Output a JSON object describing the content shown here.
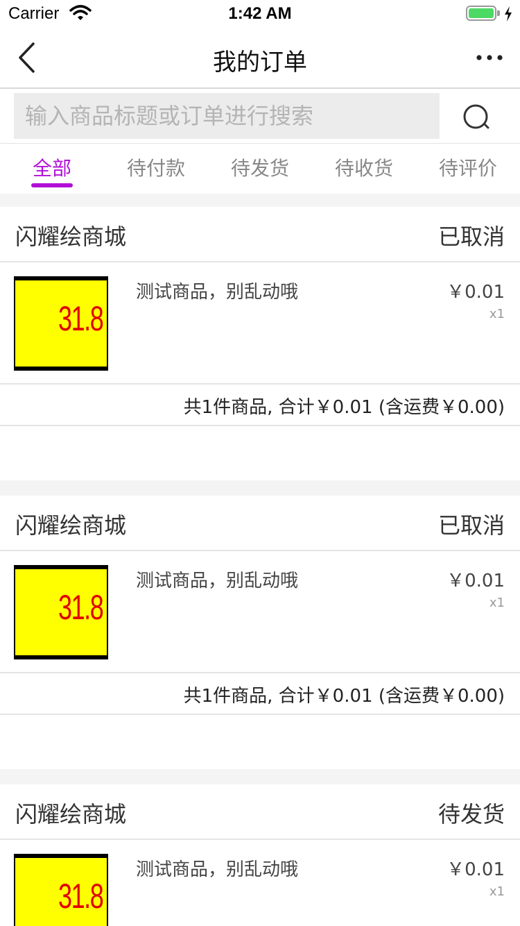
{
  "status_bar": {
    "carrier": "Carrier",
    "time": "1:42 AM"
  },
  "nav": {
    "title": "我的订单"
  },
  "search": {
    "placeholder": "输入商品标题或订单进行搜索"
  },
  "tabs": [
    {
      "label": "全部",
      "active": true
    },
    {
      "label": "待付款",
      "active": false
    },
    {
      "label": "待发货",
      "active": false
    },
    {
      "label": "待收货",
      "active": false
    },
    {
      "label": "待评价",
      "active": false
    }
  ],
  "orders": [
    {
      "shop": "闪耀绘商城",
      "status": "已取消",
      "item": {
        "thumb_text": "31.8",
        "name": "测试商品，别乱动哦",
        "price": "￥0.01",
        "qty": "x1"
      },
      "summary": "共1件商品, 合计￥0.01 (含运费￥0.00)"
    },
    {
      "shop": "闪耀绘商城",
      "status": "已取消",
      "item": {
        "thumb_text": "31.8",
        "name": "测试商品，别乱动哦",
        "price": "￥0.01",
        "qty": "x1"
      },
      "summary": "共1件商品, 合计￥0.01 (含运费￥0.00)"
    },
    {
      "shop": "闪耀绘商城",
      "status": "待发货",
      "item": {
        "thumb_text": "31.8",
        "name": "测试商品，别乱动哦",
        "price": "￥0.01",
        "qty": "x1"
      }
    }
  ],
  "colors": {
    "accent": "#b20fd6",
    "thumb_bg": "#ffff00",
    "thumb_text": "#e00000"
  },
  "icons": {
    "back": "chevron-left-icon",
    "more": "more-dots-icon",
    "search": "search-icon",
    "wifi": "wifi-icon",
    "battery": "battery-icon"
  }
}
